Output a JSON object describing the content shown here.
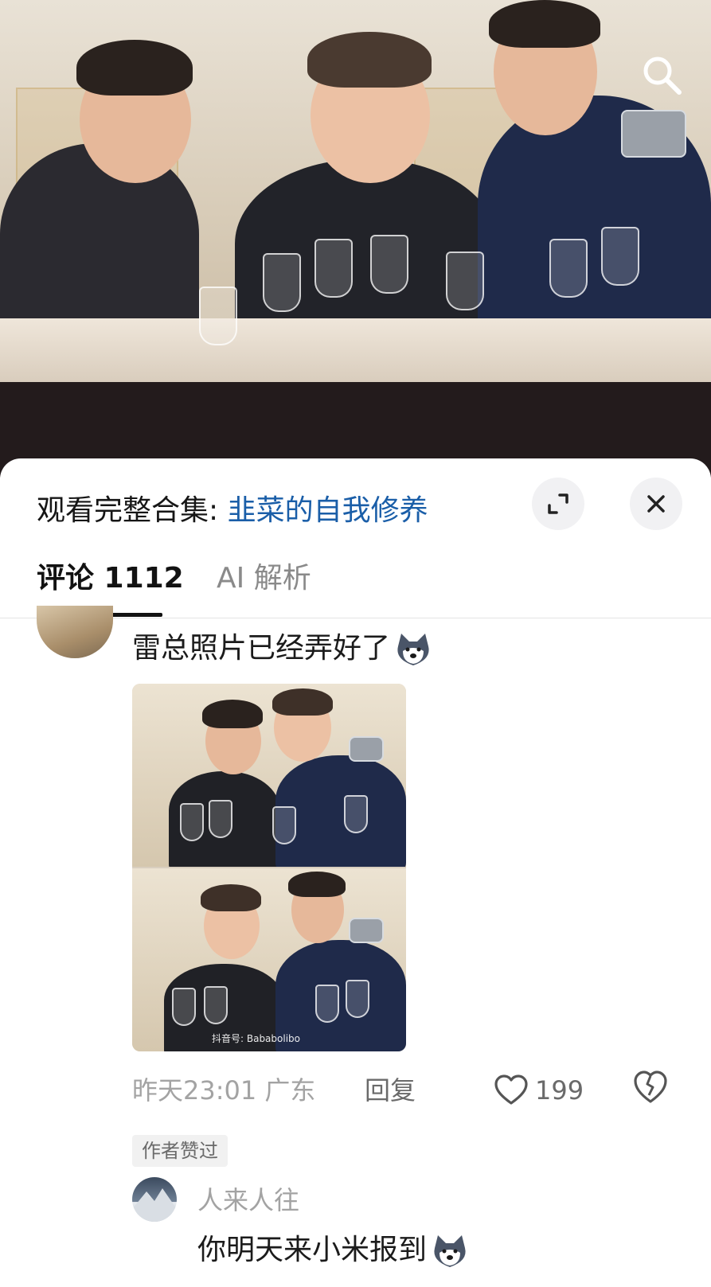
{
  "video": {
    "search_icon": "search-icon"
  },
  "sheet": {
    "collection_prefix": "观看完整合集: ",
    "collection_link": "韭菜的自我修养",
    "expand_icon": "expand-icon",
    "close_icon": "close-icon"
  },
  "tabs": [
    {
      "label": "评论 1112",
      "active": true
    },
    {
      "label": "AI 解析",
      "active": false
    }
  ],
  "comment": {
    "text": "雷总照片已经弄好了",
    "sticker": "husky-sticker",
    "image_watermark": "抖音号: Bababolibo",
    "time_location": "昨天23:01  广东",
    "reply_label": "回复",
    "like_count": "199",
    "like_icon": "heart-icon",
    "dislike_icon": "broken-heart-icon",
    "author_badge": "作者赞过"
  },
  "reply": {
    "username": "人来人往",
    "text": "你明天来小米报到",
    "sticker": "husky-sticker"
  },
  "colors": {
    "link": "#1a5ea8",
    "video_bg": "#231b1c",
    "muted_text": "#a3a3a3"
  }
}
